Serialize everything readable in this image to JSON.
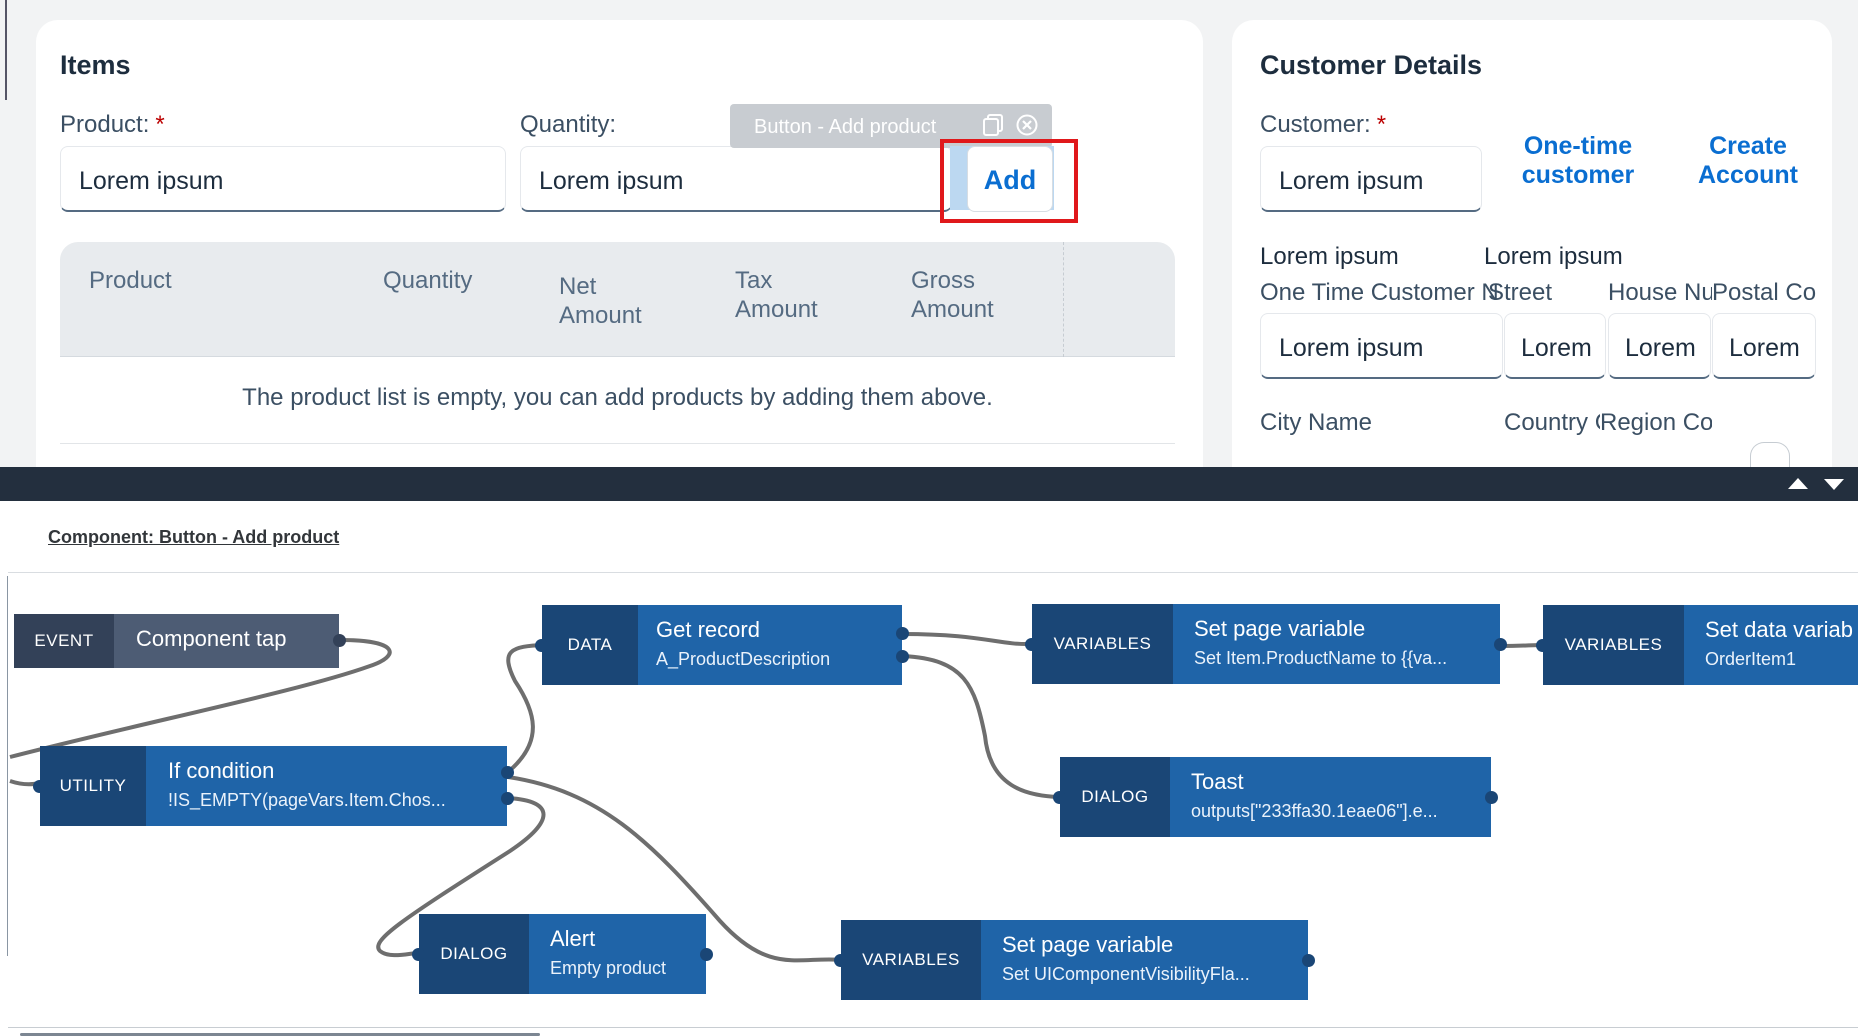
{
  "items_card": {
    "title": "Items",
    "product_label": "Product:",
    "quantity_label": "Quantity:",
    "required_mark": "*",
    "product_value": "Lorem ipsum",
    "quantity_value": "Lorem ipsum",
    "component_badge": "Button - Add product",
    "add_button": "Add",
    "table_headers": [
      "Product",
      "Quantity",
      "Net\nAmount",
      "Tax\nAmount",
      "Gross\nAmount"
    ],
    "empty_message": "The product list is empty, you can add products by adding them above."
  },
  "customer_card": {
    "title": "Customer Details",
    "customer_label": "Customer:",
    "required_mark": "*",
    "customer_value": "Lorem ipsum",
    "one_time_link": "One-time\ncustomer",
    "create_account_link": "Create\nAccount",
    "text_1": "Lorem ipsum",
    "text_2": "Lorem ipsum",
    "label_one_time_name": "One Time Customer N",
    "label_street": "Street",
    "label_house": "House Nu",
    "label_postal": "Postal Co",
    "value_one_time_name": "Lorem ipsum",
    "value_street": "Lorem",
    "value_house": "Lorem",
    "value_postal": "Lorem",
    "label_city": "City Name",
    "label_country": "Country C",
    "label_region": "Region Co"
  },
  "logic_panel": {
    "component_title": "Component: Button - Add product",
    "nodes": {
      "event": {
        "category": "EVENT",
        "title": "Component tap"
      },
      "get_record": {
        "category": "DATA",
        "title": "Get record",
        "subtitle": "A_ProductDescription"
      },
      "set_page_var_1": {
        "category": "VARIABLES",
        "title": "Set page variable",
        "subtitle": "Set Item.ProductName to {{va..."
      },
      "set_data_var": {
        "category": "VARIABLES",
        "title": "Set data variab",
        "subtitle": "OrderItem1"
      },
      "if_condition": {
        "category": "UTILITY",
        "title": "If condition",
        "subtitle": "!IS_EMPTY(pageVars.Item.Chos..."
      },
      "toast": {
        "category": "DIALOG",
        "title": "Toast",
        "subtitle": "outputs[\"233ffa30.1eae06\"].e..."
      },
      "alert": {
        "category": "DIALOG",
        "title": "Alert",
        "subtitle": "Empty product"
      },
      "set_page_var_2": {
        "category": "VARIABLES",
        "title": "Set page variable",
        "subtitle": "Set UIComponentVisibilityFla..."
      }
    }
  },
  "colors": {
    "accent_blue": "#0a6ed1",
    "selection_red": "#e0181b",
    "node_blue": "#1f64a8",
    "node_category_blue": "#1a4676",
    "event_gray": "#4d5c74",
    "splitter_dark": "#232f3e"
  },
  "icons": [
    "copy-icon",
    "close-circle-icon",
    "arrow-up-icon",
    "arrow-down-icon"
  ]
}
